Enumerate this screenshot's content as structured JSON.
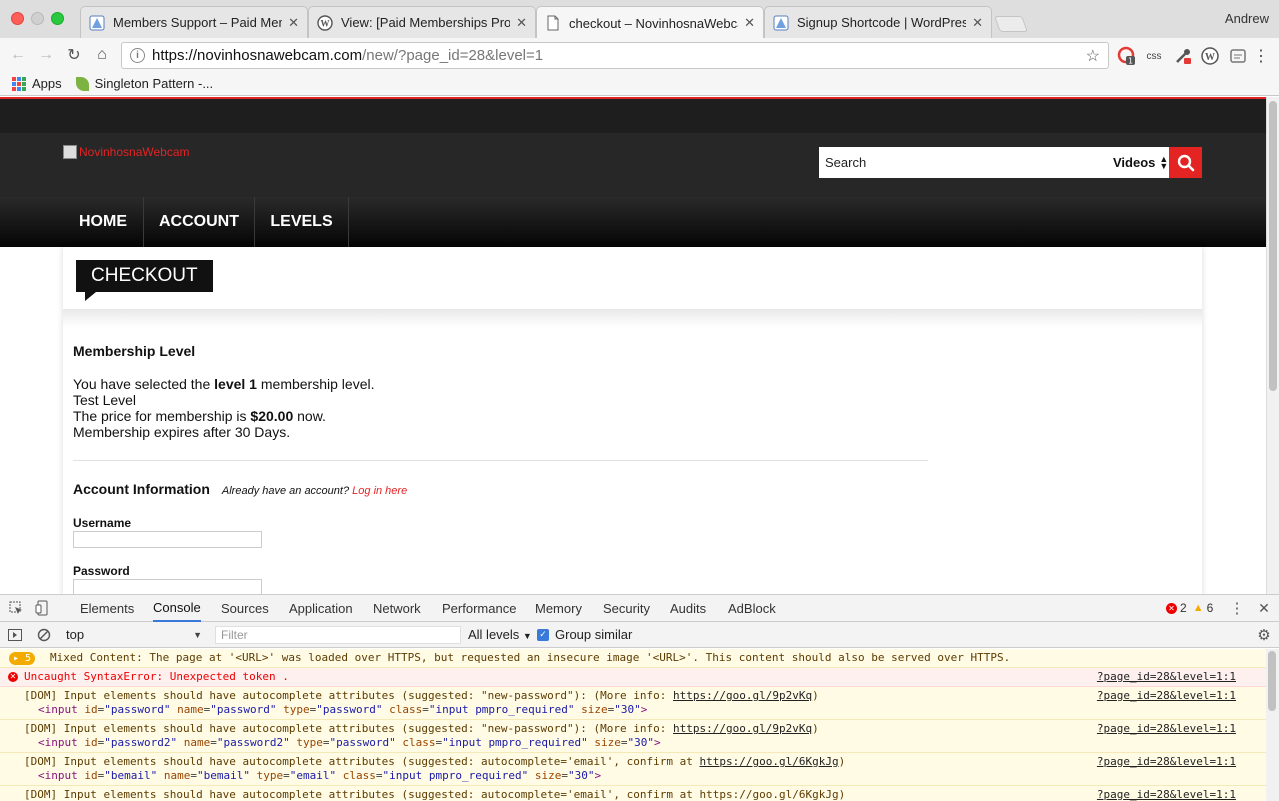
{
  "browser": {
    "tabs": [
      {
        "title": "Members Support – Paid Memb",
        "favicon": "wp-plugin-icon"
      },
      {
        "title": "View: [Paid Memberships Pro]",
        "favicon": "wordpress-icon"
      },
      {
        "title": "checkout – NovinhosnaWebcam",
        "favicon": "page-icon"
      },
      {
        "title": "Signup Shortcode | WordPress",
        "favicon": "wp-plugin-icon"
      }
    ],
    "active_tab_index": 2,
    "profile_name": "Andrew",
    "url_host": "https://novinhosnawebcam.com",
    "url_path": "/new/?page_id=28&level=1",
    "extensions": {
      "css_label": "css",
      "badge_count": "1"
    },
    "bookmarks": [
      {
        "label": "Apps",
        "icon": "apps-grid-icon"
      },
      {
        "label": "Singleton Pattern -...",
        "icon": "leaf-icon"
      }
    ]
  },
  "site": {
    "logo_alt": "NovinhosnaWebcam",
    "search": {
      "placeholder": "Search",
      "category": "Videos"
    },
    "nav": [
      "HOME",
      "ACCOUNT",
      "LEVELS"
    ],
    "accent": "#e42323"
  },
  "checkout": {
    "tag": "CHECKOUT",
    "membership_heading": "Membership Level",
    "selected_pre": "You have selected the ",
    "selected_level": "level 1",
    "selected_post": " membership level.",
    "level_name": "Test Level",
    "price_pre": "The price for membership is ",
    "price": "$20.00",
    "price_post": " now.",
    "expires": "Membership expires after 30 Days.",
    "account_heading": "Account Information",
    "already_text": "Already have an account?",
    "login_link": "Log in here",
    "username_label": "Username",
    "password_label": "Password"
  },
  "devtools": {
    "tabs": [
      "Elements",
      "Console",
      "Sources",
      "Application",
      "Network",
      "Performance",
      "Memory",
      "Security",
      "Audits",
      "AdBlock"
    ],
    "active_tab": "Console",
    "error_count": "2",
    "warning_count": "6",
    "context": "top",
    "filter_placeholder": "Filter",
    "levels_label": "All levels",
    "group_similar_label": "Group similar",
    "messages": [
      {
        "kind": "warn",
        "badge": "5",
        "text": "Mixed Content: The page at '<URL>' was loaded over HTTPS, but requested an insecure image '<URL>'. This content should also be served over HTTPS."
      },
      {
        "kind": "error",
        "text": "Uncaught SyntaxError: Unexpected token .",
        "source": "?page_id=28&level=1:1"
      },
      {
        "kind": "warn",
        "text": "[DOM] Input elements should have autocomplete attributes (suggested: \"new-password\"): (More info: ",
        "link": "https://goo.gl/9p2vKq",
        "after": ")",
        "source": "?page_id=28&level=1:1",
        "code_id": "password",
        "code_name": "password",
        "code_type": "password",
        "code_class": "input pmpro_required",
        "code_size": "30"
      },
      {
        "kind": "warn",
        "text": "[DOM] Input elements should have autocomplete attributes (suggested: \"new-password\"): (More info: ",
        "link": "https://goo.gl/9p2vKq",
        "after": ")",
        "source": "?page_id=28&level=1:1",
        "code_id": "password2",
        "code_name": "password2",
        "code_type": "password",
        "code_class": "input pmpro_required",
        "code_size": "30"
      },
      {
        "kind": "warn",
        "text": "[DOM] Input elements should have autocomplete attributes (suggested: autocomplete='email', confirm at ",
        "link": "https://goo.gl/6KgkJg",
        "after": ")",
        "source": "?page_id=28&level=1:1",
        "code_id": "bemail",
        "code_name": "bemail",
        "code_type": "email",
        "code_class": "input pmpro_required",
        "code_size": "30"
      },
      {
        "kind": "warn",
        "text": "[DOM] Input elements should have autocomplete attributes (suggested: autocomplete='email', confirm at https://goo.gl/6KgkJg)",
        "source": "?page_id=28&level=1:1"
      }
    ]
  }
}
